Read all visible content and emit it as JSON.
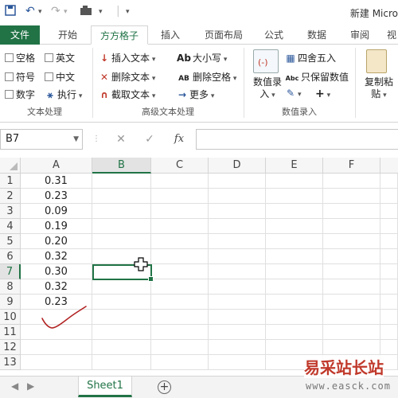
{
  "window": {
    "title": "新建 Micro"
  },
  "ribbon_tabs": [
    "文件",
    "开始",
    "方方格子",
    "插入",
    "页面布局",
    "公式",
    "数据",
    "审阅",
    "视"
  ],
  "ribbon": {
    "checkboxes": [
      "空格",
      "英文",
      "符号",
      "中文",
      "数字"
    ],
    "execute_label": "执行",
    "text_ops": [
      "插入文本",
      "删除文本",
      "截取文本"
    ],
    "case_ops": [
      "大小写",
      "删除空格",
      "更多"
    ],
    "number_ops": {
      "entry_label": "数值录入",
      "round": "四舍五入",
      "keep_numeric": "只保留数值",
      "plus": "+"
    },
    "paste_label": "复制粘贴",
    "group_labels": [
      "文本处理",
      "高级文本处理",
      "数值录入"
    ]
  },
  "formula_bar": {
    "name_box": "B7",
    "cancel": "✕",
    "confirm": "✓",
    "fx": "fx",
    "formula": ""
  },
  "grid": {
    "columns": [
      "A",
      "B",
      "C",
      "D",
      "E",
      "F"
    ],
    "selected_column": "B",
    "rows": [
      "1",
      "2",
      "3",
      "4",
      "5",
      "6",
      "7",
      "8",
      "9",
      "10",
      "11",
      "12",
      "13"
    ],
    "selected_row": "7",
    "column_a_values": [
      "0.31",
      "0.23",
      "0.09",
      "0.19",
      "0.20",
      "0.32",
      "0.30",
      "0.32",
      "0.23"
    ]
  },
  "sheets": {
    "tabs": [
      "Sheet1"
    ],
    "add": "+"
  },
  "watermark": {
    "text": "易采站长站",
    "url": "www.easck.com"
  },
  "colors": {
    "accent": "#217346",
    "ink_mark": "#b22222"
  }
}
